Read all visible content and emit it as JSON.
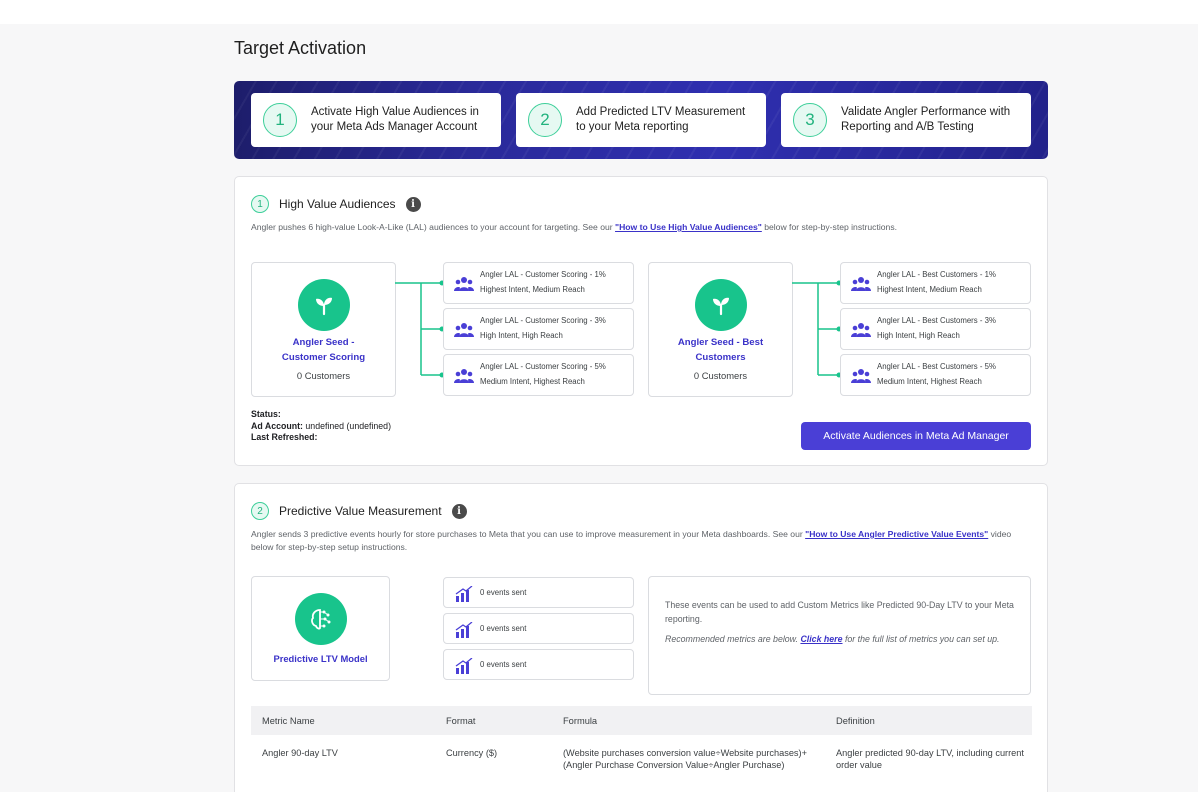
{
  "page": {
    "title": "Target Activation"
  },
  "steps": [
    {
      "num": "1",
      "text": "Activate High Value Audiences in your Meta Ads Manager Account"
    },
    {
      "num": "2",
      "text": "Add Predicted LTV Measurement to your Meta reporting"
    },
    {
      "num": "3",
      "text": "Validate Angler Performance with Reporting and A/B Testing"
    }
  ],
  "hva": {
    "num": "1",
    "title": "High Value Audiences",
    "desc_pre": "Angler pushes 6 high-value Look-A-Like (LAL) audiences to your account for targeting. See our ",
    "desc_link": "\"How to Use High Value Audiences\"",
    "desc_post": " below for step-by-step instructions.",
    "seeds": [
      {
        "name": "Angler Seed - Customer Scoring",
        "count": "0 Customers"
      },
      {
        "name": "Angler Seed - Best Customers",
        "count": "0 Customers"
      }
    ],
    "lal_scoring": [
      {
        "title": "Angler LAL - Customer Scoring - 1%",
        "sub": "Highest Intent, Medium Reach"
      },
      {
        "title": "Angler LAL - Customer Scoring - 3%",
        "sub": "High Intent, High Reach"
      },
      {
        "title": "Angler LAL - Customer Scoring - 5%",
        "sub": "Medium Intent, Highest Reach"
      }
    ],
    "lal_best": [
      {
        "title": "Angler LAL - Best Customers - 1%",
        "sub": "Highest Intent, Medium Reach"
      },
      {
        "title": "Angler LAL - Best Customers - 3%",
        "sub": "High Intent, High Reach"
      },
      {
        "title": "Angler LAL - Best Customers - 5%",
        "sub": "Medium Intent, Highest Reach"
      }
    ],
    "status_label": "Status:",
    "ad_account_label": "Ad Account:",
    "ad_account_value": " undefined (undefined)",
    "last_refreshed_label": "Last Refreshed:",
    "cta": "Activate Audiences in Meta Ad Manager"
  },
  "pvm": {
    "num": "2",
    "title": "Predictive Value Measurement",
    "desc_pre": "Angler sends 3 predictive events hourly for store purchases to Meta that you can use to improve measurement in your Meta dashboards. See our ",
    "desc_link": "\"How to Use Angler Predictive Value Events\"",
    "desc_post": " video below for step-by-step setup instructions.",
    "model_name": "Predictive LTV Model",
    "events": [
      "0 events sent",
      "0 events sent",
      "0 events sent"
    ],
    "note_1": "These events can be used to add Custom Metrics like Predicted 90-Day LTV to your Meta reporting.",
    "note_2_pre": "Recommended metrics are below. ",
    "note_2_link": "Click here",
    "note_2_post": " for the full list of metrics you can set up."
  },
  "metrics_table": {
    "headers": [
      "Metric Name",
      "Format",
      "Formula",
      "Definition"
    ],
    "rows": [
      {
        "name": "Angler 90-day LTV",
        "format": "Currency ($)",
        "formula": "(Website purchases conversion value÷Website purchases)+(Angler Purchase Conversion Value÷Angler Purchase)",
        "definition": "Angler predicted 90-day LTV, including current order value"
      }
    ]
  },
  "colors": {
    "accent": "#4a3fd6",
    "green": "#18c48c",
    "link": "#3a32c8"
  }
}
